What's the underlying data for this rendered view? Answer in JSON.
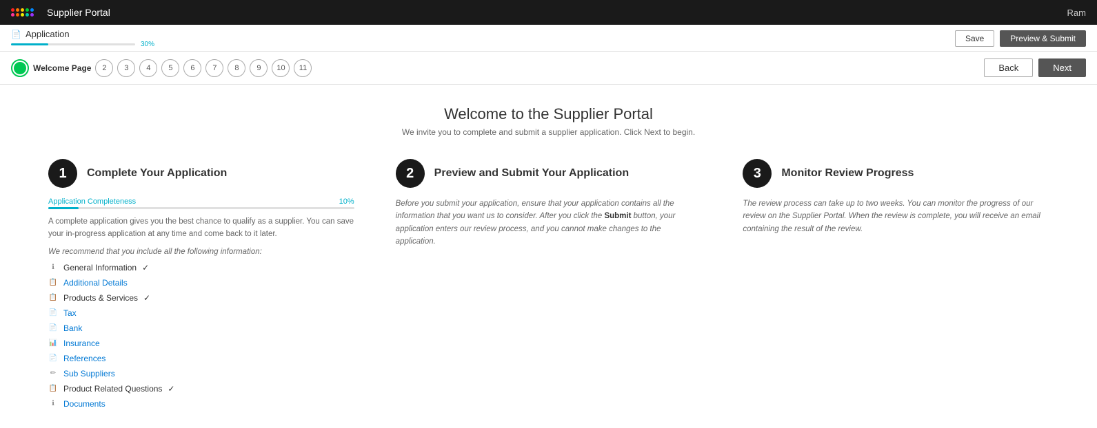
{
  "topbar": {
    "logo_alt": "Informatica",
    "title": "Supplier Portal",
    "user": "Ram"
  },
  "progress": {
    "app_title": "Application",
    "percent": "30%",
    "fill_width": "30%",
    "save_label": "Save",
    "preview_submit_label": "Preview & Submit"
  },
  "wizard": {
    "steps": [
      {
        "id": "welcome",
        "label": "Welcome Page",
        "type": "welcome"
      },
      {
        "id": "2",
        "label": "2"
      },
      {
        "id": "3",
        "label": "3"
      },
      {
        "id": "4",
        "label": "4"
      },
      {
        "id": "5",
        "label": "5"
      },
      {
        "id": "6",
        "label": "6"
      },
      {
        "id": "7",
        "label": "7"
      },
      {
        "id": "8",
        "label": "8"
      },
      {
        "id": "9",
        "label": "9"
      },
      {
        "id": "10",
        "label": "10"
      },
      {
        "id": "11",
        "label": "11"
      }
    ],
    "back_label": "Back",
    "next_label": "Next"
  },
  "welcome": {
    "title": "Welcome to the Supplier Portal",
    "subtitle": "We invite you to complete and submit a supplier application. Click Next to begin."
  },
  "step1": {
    "number": "1",
    "heading": "Complete Your Application",
    "completeness_label": "Application Completeness",
    "completeness_pct": "10%",
    "completeness_fill": "10%",
    "desc1": "A complete application gives you the best chance to qualify as a supplier. You can save your in-progress application at any time and come back to it later.",
    "recommend": "We recommend that you include all the following information:",
    "checklist": [
      {
        "icon": "ℹ",
        "label": "General Information",
        "link": false,
        "check": true
      },
      {
        "icon": "📋",
        "label": "Additional Details",
        "link": true,
        "check": false
      },
      {
        "icon": "📋",
        "label": "Products & Services",
        "link": false,
        "check": true
      },
      {
        "icon": "📄",
        "label": "Tax",
        "link": true,
        "check": false
      },
      {
        "icon": "📄",
        "label": "Bank",
        "link": true,
        "check": false
      },
      {
        "icon": "📊",
        "label": "Insurance",
        "link": true,
        "check": false
      },
      {
        "icon": "📄",
        "label": "References",
        "link": true,
        "check": false
      },
      {
        "icon": "✏",
        "label": "Sub Suppliers",
        "link": true,
        "check": false
      },
      {
        "icon": "📋",
        "label": "Product Related Questions",
        "link": false,
        "check": true
      },
      {
        "icon": "ℹ",
        "label": "Documents",
        "link": true,
        "check": false
      }
    ]
  },
  "step2": {
    "number": "2",
    "heading": "Preview and Submit Your Application",
    "body": "Before you submit your application, ensure that your application contains all the information that you want us to consider. After you click the Submit button, your application enters our review process, and you cannot make changes to the application."
  },
  "step3": {
    "number": "3",
    "heading": "Monitor Review Progress",
    "body": "The review process can take up to two weeks. You can monitor the progress of our review on the Supplier Portal. When the review is complete, you will receive an email containing the result of the review."
  },
  "logo_colors": [
    "#ff0000",
    "#ff6600",
    "#ffcc00",
    "#00cc00",
    "#0099ff",
    "#9933ff",
    "#ff0066",
    "#ff9900",
    "#ccff00",
    "#00ffcc"
  ]
}
